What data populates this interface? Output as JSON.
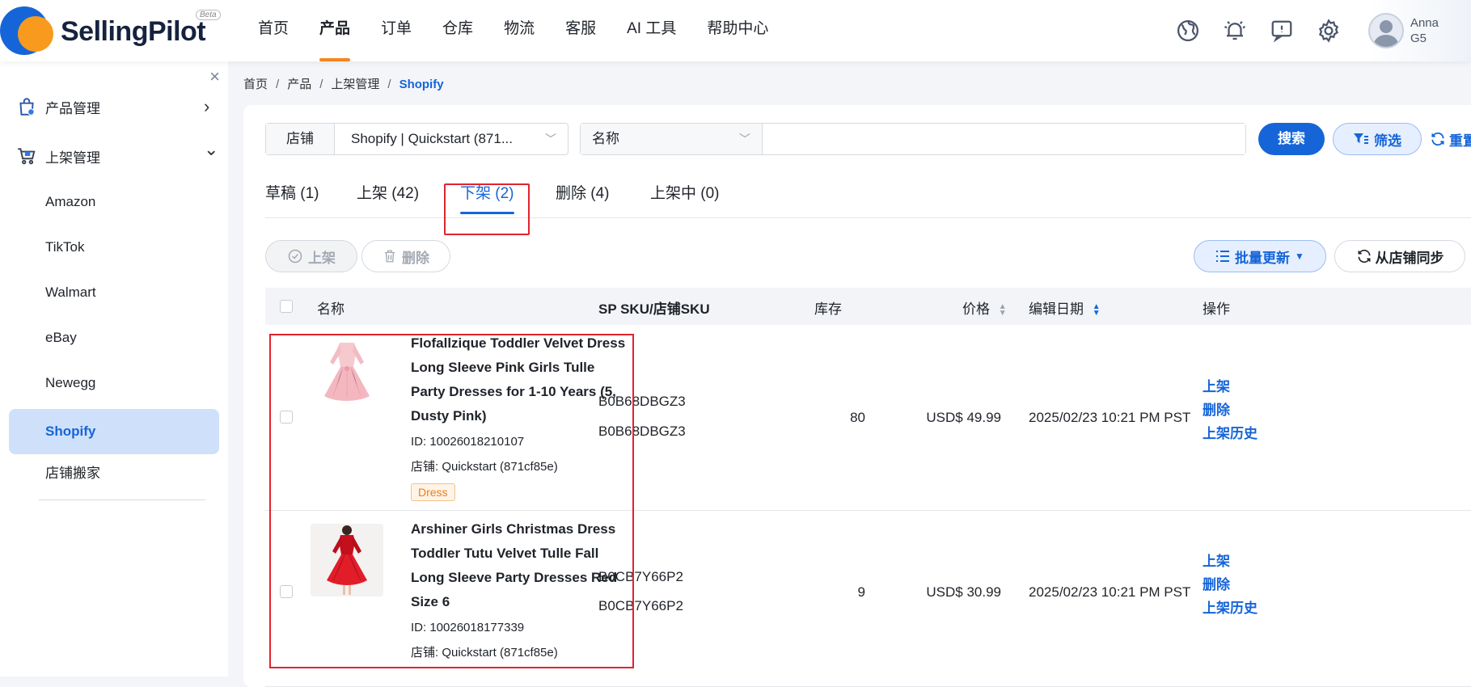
{
  "app": {
    "logo_text": "SellingPilot",
    "beta": "Beta"
  },
  "nav": [
    {
      "label": "首页"
    },
    {
      "label": "产品",
      "active": true
    },
    {
      "label": "订单"
    },
    {
      "label": "仓库"
    },
    {
      "label": "物流"
    },
    {
      "label": "客服"
    },
    {
      "label": "AI 工具"
    },
    {
      "label": "帮助中心"
    }
  ],
  "header_icons": [
    "globe-icon",
    "bell-icon",
    "message-icon",
    "gear-icon"
  ],
  "user": {
    "name": "Anna",
    "code": "G5"
  },
  "sidebar": {
    "close": "×",
    "groups": [
      {
        "label": "产品管理",
        "icon": "product-bag-icon",
        "arrow": "›"
      },
      {
        "label": "上架管理",
        "icon": "cart-icon",
        "arrow": "⌄"
      }
    ],
    "items": [
      "Amazon",
      "TikTok",
      "Walmart",
      "eBay",
      "Newegg",
      "Shopify",
      "店铺搬家"
    ],
    "active_item": "Shopify"
  },
  "breadcrumb": [
    "首页",
    "产品",
    "上架管理",
    "Shopify"
  ],
  "filters": {
    "store_label": "店铺",
    "store_value": "Shopify | Quickstart (871...",
    "name_field": "名称",
    "search_value": "",
    "search_button": "搜索",
    "filter_button": "筛选",
    "reset_button": "重置"
  },
  "tabs": [
    {
      "label": "草稿 (1)"
    },
    {
      "label": "上架 (42)"
    },
    {
      "label": "下架 (2)",
      "active": true
    },
    {
      "label": "删除 (4)"
    },
    {
      "label": "上架中 (0)"
    }
  ],
  "actions": {
    "list": "上架",
    "delete": "删除",
    "bulk_update": "批量更新",
    "sync": "从店铺同步"
  },
  "table": {
    "headers": {
      "name": "名称",
      "sku": "SP SKU/店铺SKU",
      "stock": "库存",
      "price": "价格",
      "edited": "编辑日期",
      "ops": "操作"
    },
    "rows": [
      {
        "name": "Flofallzique Toddler Velvet Dress Long Sleeve Pink Girls Tulle Party Dresses for 1-10 Years (5, Dusty Pink)",
        "id": "ID: 10026018210107",
        "store": "店铺: Quickstart (871cf85e)",
        "tag": "Dress",
        "sp_sku": "B0B68DBGZ3",
        "store_sku": "B0B68DBGZ3",
        "stock": "80",
        "price": "USD$ 49.99",
        "date": "2025/02/23 10:21 PM PST",
        "ops": [
          "上架",
          "删除",
          "上架历史"
        ]
      },
      {
        "name": "Arshiner Girls Christmas Dress Toddler Tutu Velvet Tulle Fall Long Sleeve Party Dresses Red Size 6",
        "id": "ID: 10026018177339",
        "store": "店铺: Quickstart (871cf85e)",
        "sp_sku": "B0CB7Y66P2",
        "store_sku": "B0CB7Y66P2",
        "stock": "9",
        "price": "USD$ 30.99",
        "date": "2025/02/23 10:21 PM PST",
        "ops": [
          "上架",
          "删除",
          "上架历史"
        ]
      }
    ]
  },
  "colors": {
    "primary": "#1565d8",
    "accent_orange": "#f5841f",
    "highlight_red": "#e0242e"
  }
}
